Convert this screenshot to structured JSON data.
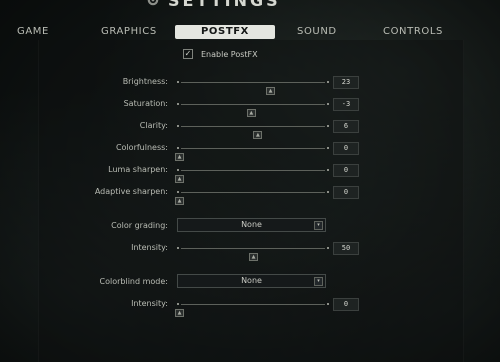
{
  "header": {
    "title": "SETTINGS",
    "icon": "gear-icon"
  },
  "tabs": [
    {
      "label": "GAME",
      "active": false
    },
    {
      "label": "GRAPHICS",
      "active": false
    },
    {
      "label": "POSTFX",
      "active": true
    },
    {
      "label": "SOUND",
      "active": false
    },
    {
      "label": "CONTROLS",
      "active": false
    }
  ],
  "enable_postfx": {
    "label": "Enable PostFX",
    "checked": true,
    "check_glyph": "✓"
  },
  "knob_glyph": "▲",
  "arrow_glyph": "▾",
  "sliders": [
    {
      "label": "Brightness:",
      "value": "23",
      "min": -100,
      "max": 100
    },
    {
      "label": "Saturation:",
      "value": "-3",
      "min": -100,
      "max": 100
    },
    {
      "label": "Clarity:",
      "value": "6",
      "min": -100,
      "max": 100
    },
    {
      "label": "Colorfulness:",
      "value": "0",
      "min": 0,
      "max": 100
    },
    {
      "label": "Luma sharpen:",
      "value": "0",
      "min": 0,
      "max": 100
    },
    {
      "label": "Adaptive sharpen:",
      "value": "0",
      "min": 0,
      "max": 100
    }
  ],
  "color_grading": {
    "label": "Color grading:",
    "selected": "None",
    "intensity": {
      "label": "Intensity:",
      "value": "50",
      "min": 0,
      "max": 100
    }
  },
  "colorblind": {
    "label": "Colorblind mode:",
    "selected": "None",
    "intensity": {
      "label": "Intensity:",
      "value": "0",
      "min": 0,
      "max": 100
    }
  },
  "colors": {
    "active_tab_bg": "#e4e6e0",
    "background": "#111615"
  }
}
